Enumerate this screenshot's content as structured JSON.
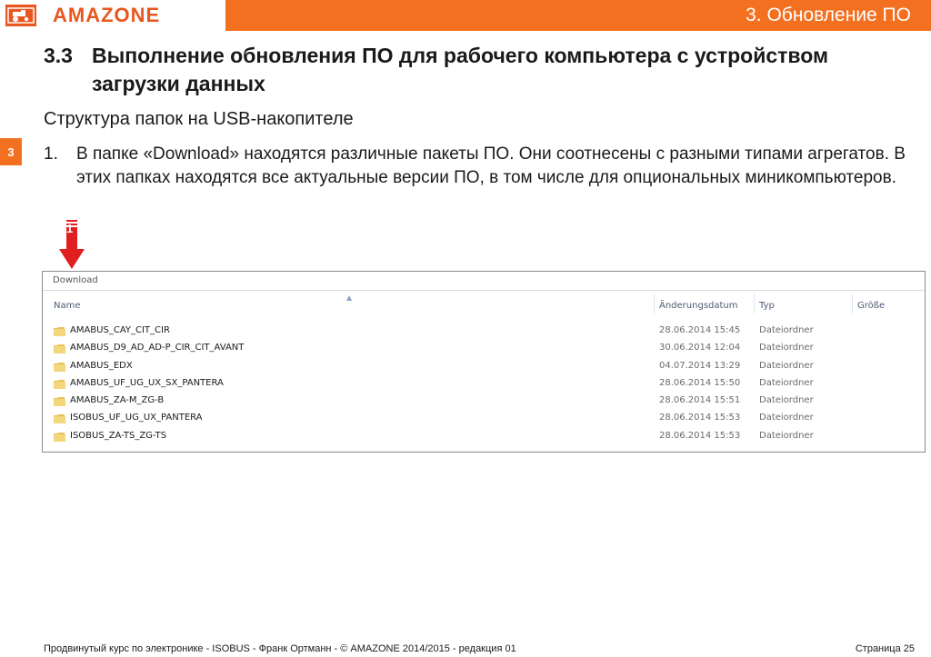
{
  "header": {
    "brand": "AMAZONE",
    "chapter_title": "3. Обновление ПО",
    "accent_color": "#f37021",
    "logo_icon": "amazone-tractor-logo"
  },
  "side_tab": {
    "chapter": "3"
  },
  "section": {
    "number": "3.3",
    "title": "Выполнение обновления ПО для рабочего компьютера с устройством загрузки данных"
  },
  "subheading": "Структура папок на USB-накопителе",
  "step": {
    "number": "1.",
    "text": "В папке «Download» находятся различные пакеты ПО. Они соотнесены с разными типами агрегатов. В этих папках находятся все актуальные версии ПО, в том числе для опциональных миникомпьютеров."
  },
  "marker": {
    "label": "1",
    "icon": "red-down-arrow-icon"
  },
  "explorer": {
    "path": "Download",
    "columns": [
      "Name",
      "Änderungsdatum",
      "Typ",
      "Größe"
    ],
    "rows": [
      {
        "name": "AMABUS_CAY_CIT_CIR",
        "date": "28.06.2014 15:45",
        "type": "Dateiordner"
      },
      {
        "name": "AMABUS_D9_AD_AD-P_CIR_CIT_AVANT",
        "date": "30.06.2014 12:04",
        "type": "Dateiordner"
      },
      {
        "name": "AMABUS_EDX",
        "date": "04.07.2014 13:29",
        "type": "Dateiordner"
      },
      {
        "name": "AMABUS_UF_UG_UX_SX_PANTERA",
        "date": "28.06.2014 15:50",
        "type": "Dateiordner"
      },
      {
        "name": "AMABUS_ZA-M_ZG-B",
        "date": "28.06.2014 15:51",
        "type": "Dateiordner"
      },
      {
        "name": "ISOBUS_UF_UG_UX_PANTERA",
        "date": "28.06.2014 15:53",
        "type": "Dateiordner"
      },
      {
        "name": "ISOBUS_ZA-TS_ZG-TS",
        "date": "28.06.2014 15:53",
        "type": "Dateiordner"
      }
    ]
  },
  "footer": {
    "course": "Продвинутый курс по электронике - ISOBUS - Франк Ортманн - © AMAZONE 2014/2015 - редакция 01",
    "page": "Страница 25"
  }
}
